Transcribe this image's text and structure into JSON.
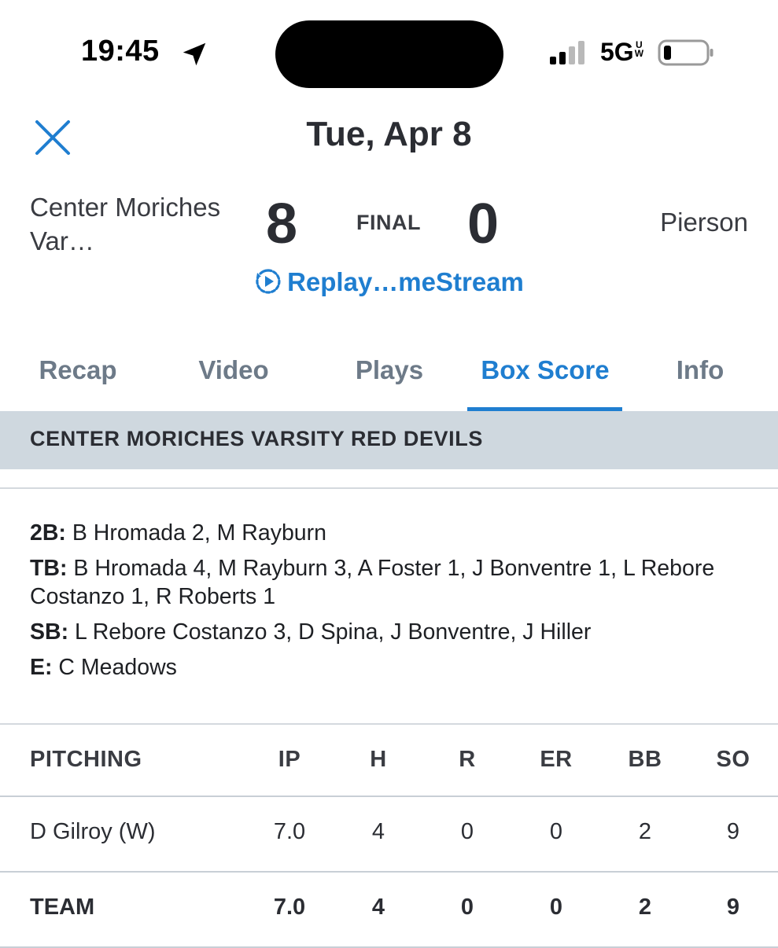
{
  "status_bar": {
    "time": "19:45",
    "network": "5G",
    "network_suffix_top": "U",
    "network_suffix_bottom": "W"
  },
  "header": {
    "date": "Tue, Apr 8"
  },
  "scoreboard": {
    "home_team": "Center Moriches Var…",
    "home_score": "8",
    "status": "FINAL",
    "away_score": "0",
    "away_team": "Pierson",
    "replay_label": "Replay…meStream"
  },
  "tabs": [
    {
      "label": "Recap"
    },
    {
      "label": "Video"
    },
    {
      "label": "Plays"
    },
    {
      "label": "Box Score",
      "active": true
    },
    {
      "label": "Info"
    }
  ],
  "team_section": {
    "title": "CENTER MORICHES VARSITY RED DEVILS"
  },
  "notes": [
    {
      "key": "2B:",
      "value": "B Hromada 2, M Rayburn"
    },
    {
      "key": "TB:",
      "value": "B Hromada 4, M Rayburn 3, A Foster 1, J Bonventre 1, L Rebore Costanzo 1, R Roberts 1"
    },
    {
      "key": "SB:",
      "value": "L Rebore Costanzo 3, D Spina, J Bonventre, J Hiller"
    },
    {
      "key": "E:",
      "value": "C Meadows"
    }
  ],
  "pitching": {
    "headers": [
      "PITCHING",
      "IP",
      "H",
      "R",
      "ER",
      "BB",
      "SO"
    ],
    "rows": [
      [
        "D Gilroy (W)",
        "7.0",
        "4",
        "0",
        "0",
        "2",
        "9"
      ],
      [
        "TEAM",
        "7.0",
        "4",
        "0",
        "0",
        "2",
        "9"
      ]
    ]
  },
  "colors": {
    "accent": "#1f7ed0",
    "band": "#cfd8df",
    "tab_inactive": "#6d7a88"
  }
}
